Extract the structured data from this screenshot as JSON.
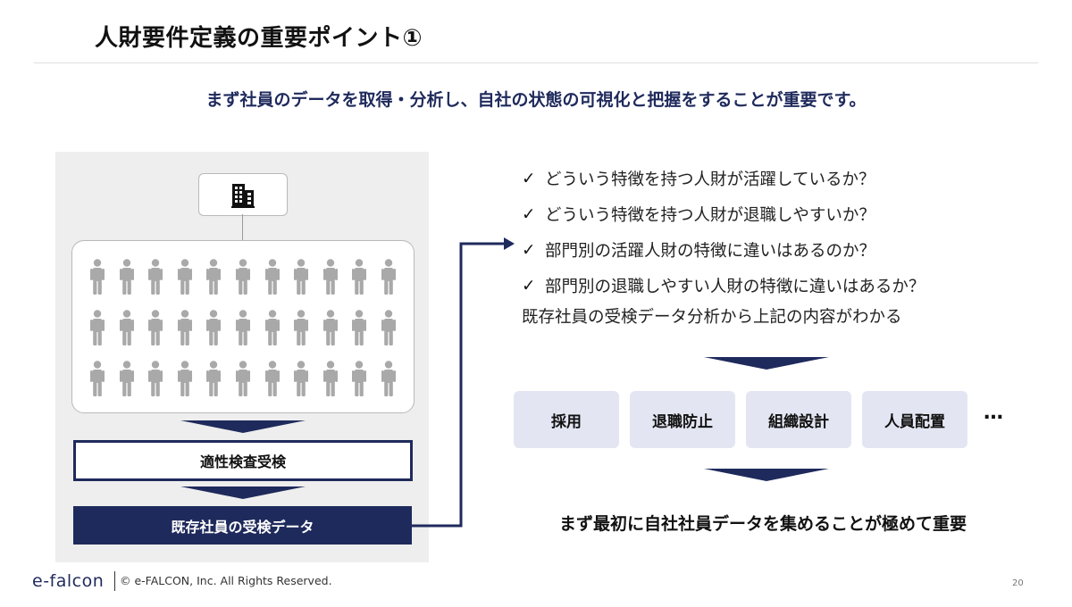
{
  "slide": {
    "title": "人財要件定義の重要ポイント①",
    "subtitle": "まず社員のデータを取得・分析し、自社の状態の可視化と把握をすることが重要です。"
  },
  "left_panel": {
    "building_icon": "office-building-icon",
    "people_icon": "person-icon",
    "people_grid": {
      "rows": 3,
      "columns": 11
    },
    "step_label": "適性検査受検",
    "data_label": "既存社員の受検データ"
  },
  "right_panel": {
    "check_mark": "✓",
    "questions": [
      "どういう特徴を持つ人財が活躍しているか？",
      "どういう特徴を持つ人財が退職しやすいか？",
      "部門別の活躍人財の特徴に違いはあるのか？",
      "部門別の退職しやすい人財の特徴に違いはあるか？"
    ],
    "summary": "既存社員の受検データ分析から上記の内容がわかる",
    "uses": [
      "採用",
      "退職防止",
      "組織設計",
      "人員配置"
    ],
    "ellipsis": "…",
    "conclusion": "まず最初に自社社員データを集めることが極めて重要"
  },
  "footer": {
    "logo": "e-falcon",
    "copyright": "© e-FALCON, Inc. All Rights Reserved.",
    "page_number": "20"
  },
  "colors": {
    "navy": "#1f2a5c",
    "panel_gray": "#eeeeee",
    "person_gray": "#a9a9a9",
    "chip_lavender": "#e3e6f2"
  }
}
